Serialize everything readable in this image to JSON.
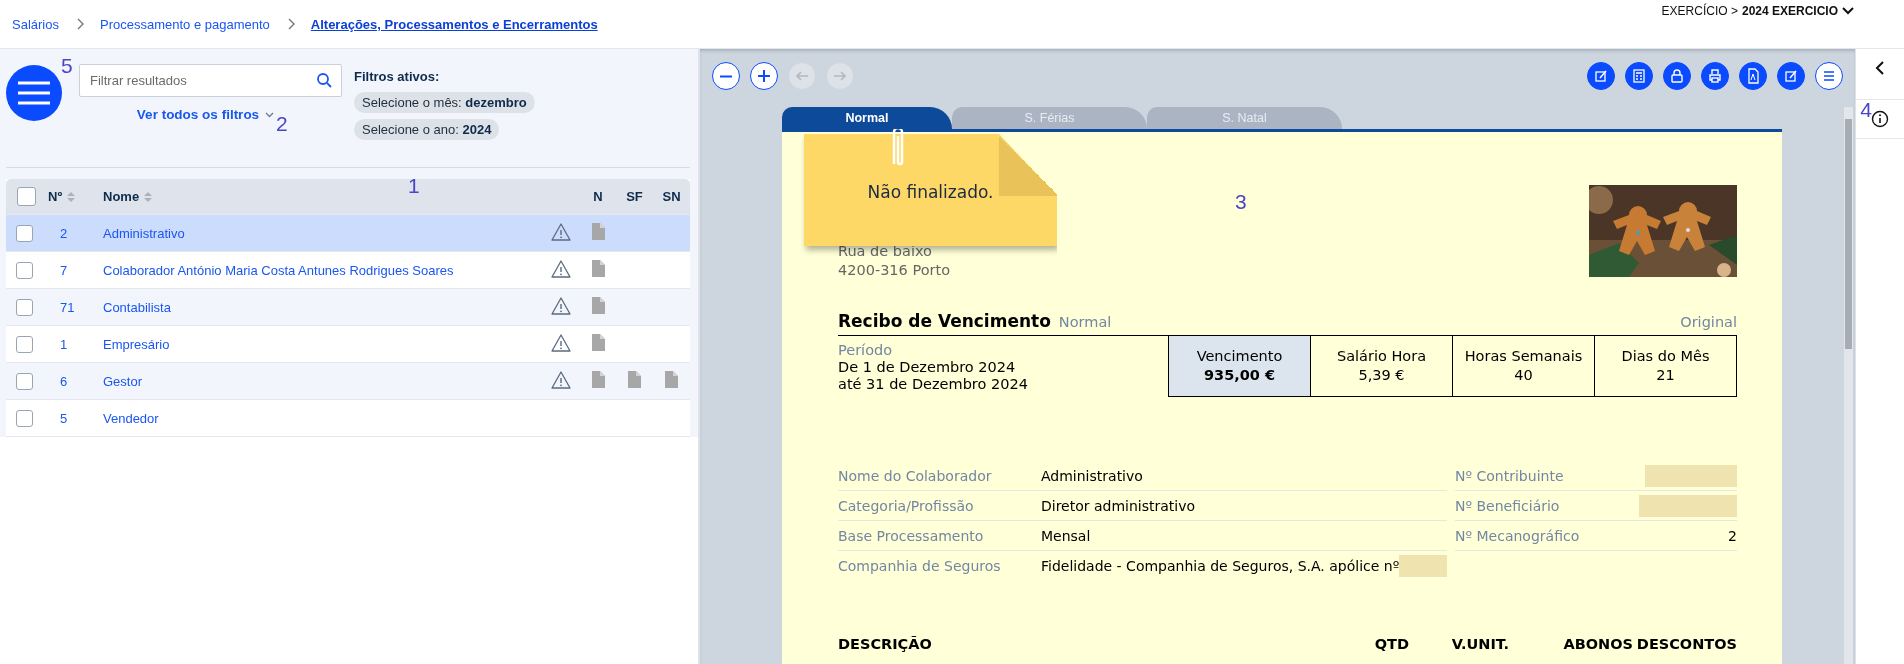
{
  "breadcrumb": [
    {
      "label": "Salários",
      "current": false
    },
    {
      "label": "Processamento e pagamento",
      "current": false
    },
    {
      "label": "Alterações, Processamentos e Encerramentos",
      "current": true
    }
  ],
  "exercise": {
    "prefix": "EXERCÍCIO >",
    "value": "2024 EXERCICIO"
  },
  "filter": {
    "placeholder": "Filtrar resultados",
    "all_filters_link": "Ver todos os filtros",
    "active_title": "Filtros ativos:",
    "chips": [
      {
        "label": "Selecione o mês:",
        "value": "dezembro"
      },
      {
        "label": "Selecione o ano:",
        "value": "2024"
      }
    ]
  },
  "table": {
    "select_all_checked": false,
    "columns": [
      "Nº",
      "Nome",
      "N",
      "SF",
      "SN"
    ],
    "rows": [
      {
        "number": "2",
        "name": "Administrativo",
        "selected": true,
        "checked": false,
        "warning": true,
        "documents": [
          true,
          false,
          false
        ]
      },
      {
        "number": "7",
        "name": "Colaborador António Maria Costa Antunes Rodrigues Soares",
        "selected": false,
        "checked": false,
        "warning": true,
        "documents": [
          true,
          false,
          false
        ]
      },
      {
        "number": "71",
        "name": "Contabilista",
        "selected": false,
        "checked": false,
        "warning": true,
        "documents": [
          true,
          false,
          false
        ]
      },
      {
        "number": "1",
        "name": "Empresário",
        "selected": false,
        "checked": false,
        "warning": true,
        "documents": [
          true,
          false,
          false
        ]
      },
      {
        "number": "6",
        "name": "Gestor",
        "selected": false,
        "checked": false,
        "warning": true,
        "documents": [
          true,
          true,
          true
        ]
      },
      {
        "number": "5",
        "name": "Vendedor",
        "selected": false,
        "checked": false,
        "warning": false,
        "documents": [
          false,
          false,
          false
        ]
      }
    ]
  },
  "viewer": {
    "nav": [
      {
        "kind": "zoom-out",
        "disabled": false
      },
      {
        "kind": "zoom-in",
        "disabled": false
      },
      {
        "kind": "back",
        "disabled": true
      },
      {
        "kind": "forward",
        "disabled": true
      }
    ],
    "tabs": [
      {
        "label": "Normal",
        "selected": true
      },
      {
        "label": "S. Férias",
        "selected": false
      },
      {
        "label": "S. Natal",
        "selected": false
      }
    ]
  },
  "document": {
    "note": "Não finalizado.",
    "address": [
      "Rua de baixo",
      "4200-316 Porto"
    ],
    "title": "Recibo de Vencimento",
    "type": "Normal",
    "copy": "Original",
    "period_label": "Período",
    "period": [
      "De 1 de Dezembro 2024",
      "até 31 de Dezembro 2024"
    ],
    "summary": [
      {
        "label": "Vencimento",
        "value": "935,00 €",
        "highlight": true
      },
      {
        "label": "Salário Hora",
        "value": "5,39 €",
        "highlight": false
      },
      {
        "label": "Horas Semanais",
        "value": "40",
        "highlight": false
      },
      {
        "label": "Dias do Mês",
        "value": "21",
        "highlight": false
      }
    ],
    "details_left": [
      {
        "label": "Nome do Colaborador",
        "value": "Administrativo",
        "redacted": false
      },
      {
        "label": "Categoria/Profissão",
        "value": "Diretor administrativo",
        "redacted": false
      },
      {
        "label": "Base Processamento",
        "value": "Mensal",
        "redacted": false
      },
      {
        "label": "Companhia de Seguros",
        "value": "Fidelidade - Companhia de Seguros, S.A. apólice nº",
        "redacted": true
      }
    ],
    "details_right": [
      {
        "label": "Nº Contribuinte",
        "redacted": true
      },
      {
        "label": "Nº Beneficiário",
        "redacted": true
      },
      {
        "label": "Nº Mecanográfico",
        "value": "2",
        "redacted": false
      }
    ],
    "columns": [
      "DESCRIÇÃO",
      "QTD",
      "V.UNIT.",
      "ABONOS",
      "DESCONTOS"
    ]
  },
  "callouts": {
    "menu": "5",
    "filters": "2",
    "table": "1",
    "document": "3",
    "info": "4"
  }
}
